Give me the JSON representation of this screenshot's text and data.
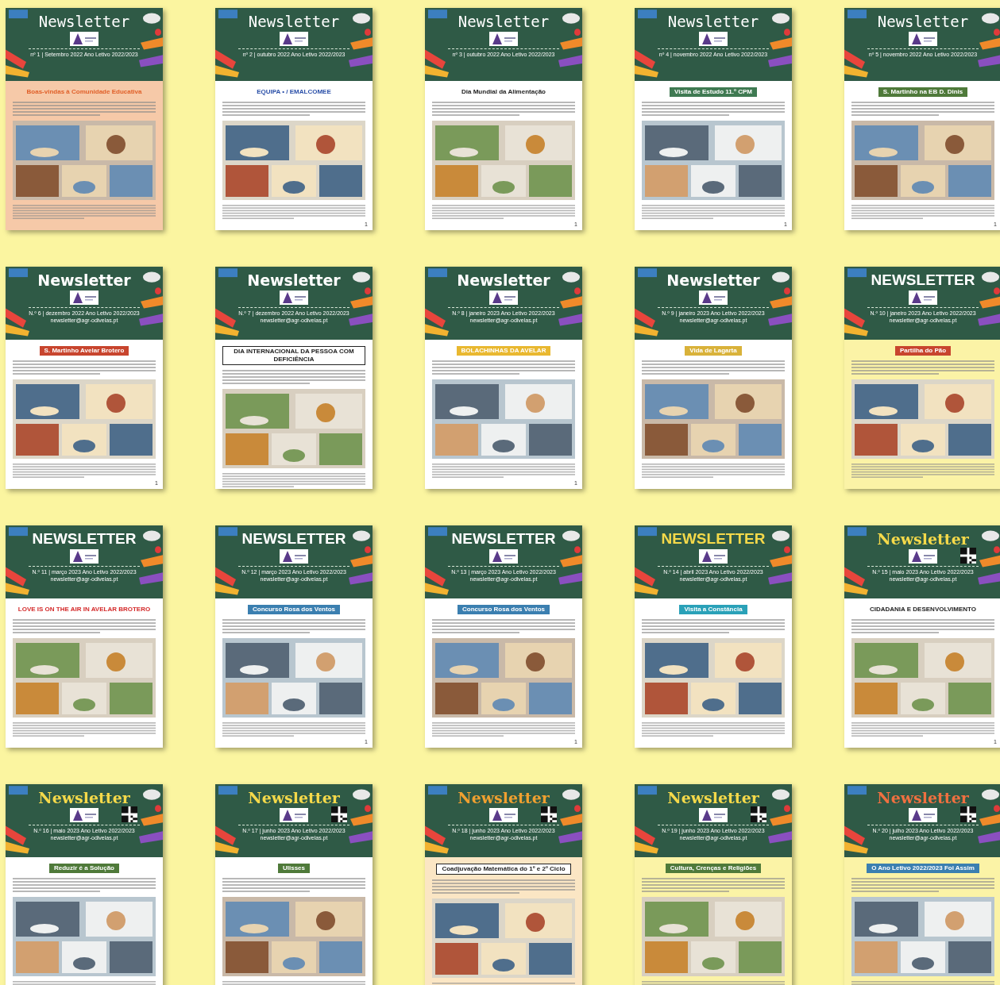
{
  "newsletters": [
    {
      "masthead": {
        "text": "Newsletter",
        "kind": "chalk",
        "color": "#ffffff"
      },
      "issue": "nº 1 | Setembro 2022   Ano Letivo 2022/2023",
      "qr": false,
      "headline": {
        "text": "Boas-vindas à Comunidade Educativa",
        "kind": "plain",
        "color": "#e0602a"
      },
      "paper": {
        "color": "#f6c9a8"
      }
    },
    {
      "masthead": {
        "text": "Newsletter",
        "kind": "chalk",
        "color": "#ffffff"
      },
      "issue": "nº 2 | outubro 2022   Ano Letivo 2022/2023",
      "qr": false,
      "headline": {
        "text": "EQUIPA • / EMALCOMEE",
        "kind": "plain",
        "color": "#2a4fa8"
      },
      "paper": {
        "color": "#ffffff"
      },
      "page_number": "1"
    },
    {
      "masthead": {
        "text": "Newsletter",
        "kind": "chalk",
        "color": "#ffffff"
      },
      "issue": "nº 3 | outubro 2022   Ano Letivo 2022/2023",
      "qr": false,
      "headline": {
        "text": "Dia Mundial da Alimentação",
        "kind": "plain",
        "color": "#222222"
      },
      "paper": {
        "color": "#ffffff"
      },
      "page_number": "1"
    },
    {
      "masthead": {
        "text": "Newsletter",
        "kind": "chalk",
        "color": "#ffffff"
      },
      "issue": "nº 4 | novembro 2022   Ano Letivo 2022/2023",
      "qr": false,
      "headline": {
        "text": "Visita de Estudo 11.º CPM",
        "kind": "banner",
        "color": "#3f7a52"
      },
      "paper": {
        "color": "#ffffff"
      },
      "page_number": "1"
    },
    {
      "masthead": {
        "text": "Newsletter",
        "kind": "chalk",
        "color": "#ffffff"
      },
      "issue": "nº 5 | novembro 2022   Ano Letivo 2022/2023",
      "qr": false,
      "headline": {
        "text": "S. Martinho na EB D. Dinis",
        "kind": "banner",
        "color": "#4f7a3a"
      },
      "paper": {
        "color": "#ffffff"
      },
      "page_number": "1"
    },
    {
      "masthead": {
        "text": "Newsletter",
        "kind": "sans",
        "color": "#ffffff"
      },
      "issue": "N.º 6 | dezembro 2022   Ano Letivo 2022/2023",
      "email": "newsletter@agr-odivelas.pt",
      "qr": false,
      "headline": {
        "text": "S. Martinho Avelar Brotero",
        "kind": "banner",
        "color": "#c8452e"
      },
      "paper": {
        "color": "#ffffff"
      },
      "page_number": "1"
    },
    {
      "masthead": {
        "text": "Newsletter",
        "kind": "sans",
        "color": "#ffffff"
      },
      "issue": "N.º 7 | dezembro 2022   Ano Letivo 2022/2023",
      "email": "newsletter@agr-odivelas.pt",
      "qr": false,
      "headline": {
        "text": "DIA INTERNACIONAL DA PESSOA COM DEFICIÊNCIA",
        "kind": "boxed",
        "color": "#222222"
      },
      "paper": {
        "color": "#ffffff"
      }
    },
    {
      "masthead": {
        "text": "Newsletter",
        "kind": "sans",
        "color": "#ffffff"
      },
      "issue": "N.º 8 | janeiro 2023   Ano Letivo 2022/2023",
      "email": "newsletter@agr-odivelas.pt",
      "qr": false,
      "headline": {
        "text": "BOLACHINHAS DA AVELAR",
        "kind": "banner",
        "color": "#e9b830"
      },
      "paper": {
        "color": "#ffffff"
      },
      "page_number": "1"
    },
    {
      "masthead": {
        "text": "Newsletter",
        "kind": "sans",
        "color": "#ffffff"
      },
      "issue": "N.º 9 | janeiro 2023   Ano Letivo 2022/2023",
      "email": "newsletter@agr-odivelas.pt",
      "qr": false,
      "headline": {
        "text": "Vida de Lagarta",
        "kind": "banner",
        "color": "#d9b23a"
      },
      "paper": {
        "color": "#ffffff"
      }
    },
    {
      "masthead": {
        "text": "NEWSLETTER",
        "kind": "caps",
        "color": "#ffffff"
      },
      "issue": "N.º 10 | janeiro 2023   Ano Letivo 2022/2023",
      "email": "newsletter@agr-odivelas.pt",
      "qr": false,
      "headline": {
        "text": "Partilha do Pão",
        "kind": "banner",
        "color": "#c8452e"
      },
      "paper": {
        "color": "#fbf3a6"
      }
    },
    {
      "masthead": {
        "text": "NEWSLETTER",
        "kind": "caps",
        "color": "#ffffff"
      },
      "issue": "N.º 11 | março 2023   Ano Letivo 2022/2023",
      "email": "newsletter@agr-odivelas.pt",
      "qr": false,
      "headline": {
        "text": "LOVE IS ON THE AIR IN AVELAR BROTERO",
        "kind": "plain",
        "color": "#d42a2a"
      },
      "paper": {
        "color": "#ffffff"
      }
    },
    {
      "masthead": {
        "text": "NEWSLETTER",
        "kind": "caps",
        "color": "#ffffff"
      },
      "issue": "N.º 12 | março 2023   Ano Letivo 2022/2023",
      "email": "newsletter@agr-odivelas.pt",
      "qr": false,
      "headline": {
        "text": "Concurso Rosa dos Ventos",
        "kind": "banner",
        "color": "#3b7fb0"
      },
      "paper": {
        "color": "#ffffff"
      },
      "page_number": "1"
    },
    {
      "masthead": {
        "text": "NEWSLETTER",
        "kind": "caps",
        "color": "#ffffff"
      },
      "issue": "N.º 13 | março 2023   Ano Letivo 2022/2023",
      "email": "newsletter@agr-odivelas.pt",
      "qr": false,
      "headline": {
        "text": "Concurso Rosa dos Ventos",
        "kind": "banner",
        "color": "#3b7fb0"
      },
      "paper": {
        "color": "#ffffff"
      },
      "page_number": "1"
    },
    {
      "masthead": {
        "text": "NEWSLETTER",
        "kind": "caps",
        "color": "#f5d94a"
      },
      "issue": "N.º 14 | abril 2023   Ano Letivo 2022/2023",
      "email": "newsletter@agr-odivelas.pt",
      "qr": false,
      "headline": {
        "text": "Visita a Constância",
        "kind": "banner",
        "color": "#2aa1b8"
      },
      "paper": {
        "color": "#ffffff"
      }
    },
    {
      "masthead": {
        "text": "Newsletter",
        "kind": "serif",
        "color": "#f5d94a"
      },
      "issue": "N.º 15 | maio 2023   Ano Letivo 2022/2023",
      "email": "newsletter@agr-odivelas.pt",
      "qr": true,
      "headline": {
        "text": "CIDADANIA E DESENVOLVIMENTO",
        "kind": "plain",
        "color": "#222222"
      },
      "paper": {
        "color": "#ffffff"
      },
      "page_number": "1"
    },
    {
      "masthead": {
        "text": "Newsletter",
        "kind": "serif",
        "color": "#f5d94a"
      },
      "issue": "N.º 16 | maio 2023   Ano Letivo 2022/2023",
      "email": "newsletter@agr-odivelas.pt",
      "qr": true,
      "headline": {
        "text": "Reduzir é a Solução",
        "kind": "banner",
        "color": "#4f7a3a"
      },
      "paper": {
        "color": "#ffffff"
      }
    },
    {
      "masthead": {
        "text": "Newsletter",
        "kind": "serif",
        "color": "#f5d94a"
      },
      "issue": "N.º 17 | junho 2023   Ano Letivo 2022/2023",
      "email": "newsletter@agr-odivelas.pt",
      "qr": true,
      "headline": {
        "text": "Ulisses",
        "kind": "banner",
        "color": "#4f7a3a"
      },
      "paper": {
        "color": "#ffffff"
      }
    },
    {
      "masthead": {
        "text": "Newsletter",
        "kind": "serif",
        "color": "#f0a030"
      },
      "issue": "N.º 18 | junho 2023   Ano Letivo 2022/2023",
      "email": "newsletter@agr-odivelas.pt",
      "qr": true,
      "headline": {
        "text": "Coadjuvação Matemática do 1º e 2º Ciclo",
        "kind": "boxed",
        "color": "#222222"
      },
      "paper": {
        "color": "#fbe6c4"
      }
    },
    {
      "masthead": {
        "text": "Newsletter",
        "kind": "serif",
        "color": "#f5d94a"
      },
      "issue": "N.º 19 | junho 2023   Ano Letivo 2022/2023",
      "email": "newsletter@agr-odivelas.pt",
      "qr": true,
      "headline": {
        "text": "Cultura, Crenças e Religiões",
        "kind": "banner",
        "color": "#4f7a3a"
      },
      "paper": {
        "color": "#fbf3a6"
      }
    },
    {
      "masthead": {
        "text": "Newsletter",
        "kind": "serif",
        "color": "#f07040"
      },
      "issue": "N.º 20 | julho 2023   Ano Letivo 2022/2023",
      "email": "newsletter@agr-odivelas.pt",
      "qr": true,
      "headline": {
        "text": "O Ano Letivo 2022/2023 Foi Assim",
        "kind": "banner",
        "color": "#3b7fb0"
      },
      "paper": {
        "color": "#fbf3a6"
      }
    }
  ]
}
